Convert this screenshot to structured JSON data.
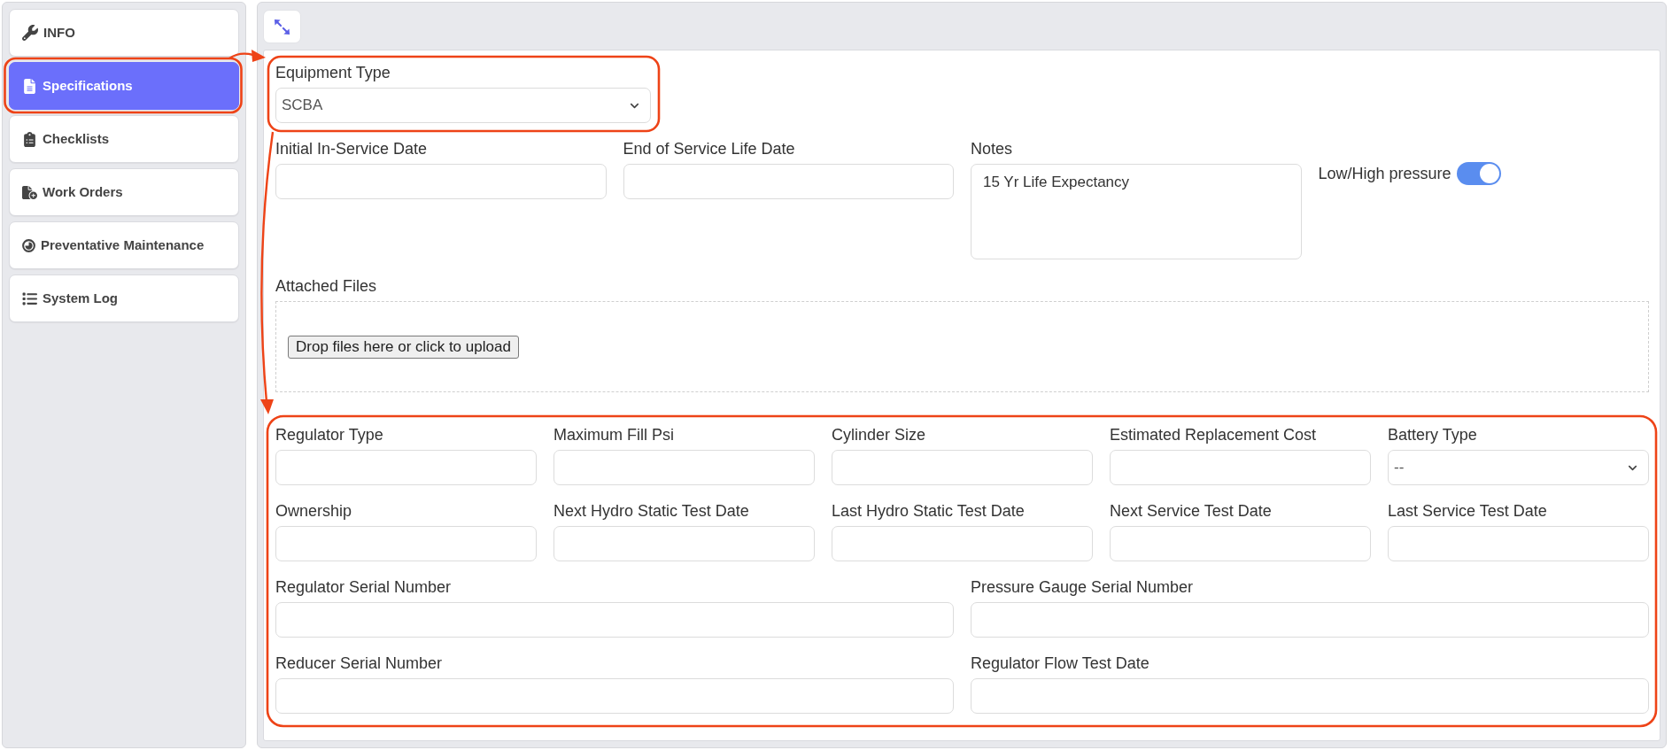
{
  "sidebar": {
    "items": [
      {
        "label": "INFO",
        "selected": false
      },
      {
        "label": "Specifications",
        "selected": true
      },
      {
        "label": "Checklists",
        "selected": false
      },
      {
        "label": "Work Orders",
        "selected": false
      },
      {
        "label": "Preventative Maintenance",
        "selected": false
      },
      {
        "label": "System Log",
        "selected": false
      }
    ]
  },
  "equipment_type": {
    "label": "Equipment Type",
    "value": "SCBA"
  },
  "service_row": [
    {
      "kind": "input",
      "label": "Initial In-Service Date"
    },
    {
      "kind": "input",
      "label": "End of Service Life Date"
    },
    {
      "kind": "textarea",
      "label": "Notes",
      "value": "15 Yr Life Expectancy"
    },
    {
      "kind": "toggle",
      "label": "Low/High pressure",
      "on": true
    }
  ],
  "attached_files": {
    "label": "Attached Files",
    "upload_button": "Drop files here or click to upload"
  },
  "detail_rows": [
    {
      "fields": [
        {
          "kind": "input",
          "label": "Regulator Type"
        },
        {
          "kind": "input",
          "label": "Maximum Fill Psi"
        },
        {
          "kind": "input",
          "label": "Cylinder Size"
        },
        {
          "kind": "input",
          "label": "Estimated Replacement Cost"
        },
        {
          "kind": "select",
          "label": "Battery Type",
          "value": "--"
        }
      ]
    },
    {
      "fields": [
        {
          "kind": "input",
          "label": "Ownership"
        },
        {
          "kind": "input",
          "label": "Next Hydro Static Test Date"
        },
        {
          "kind": "input",
          "label": "Last Hydro Static Test Date"
        },
        {
          "kind": "input",
          "label": "Next Service Test Date"
        },
        {
          "kind": "input",
          "label": "Last Service Test Date"
        }
      ]
    },
    {
      "fields": [
        {
          "kind": "input",
          "label": "Regulator Serial Number"
        },
        {
          "kind": "input",
          "label": "Pressure Gauge Serial Number"
        }
      ]
    },
    {
      "fields": [
        {
          "kind": "input",
          "label": "Reducer Serial Number"
        },
        {
          "kind": "input",
          "label": "Regulator Flow Test Date"
        }
      ]
    }
  ]
}
